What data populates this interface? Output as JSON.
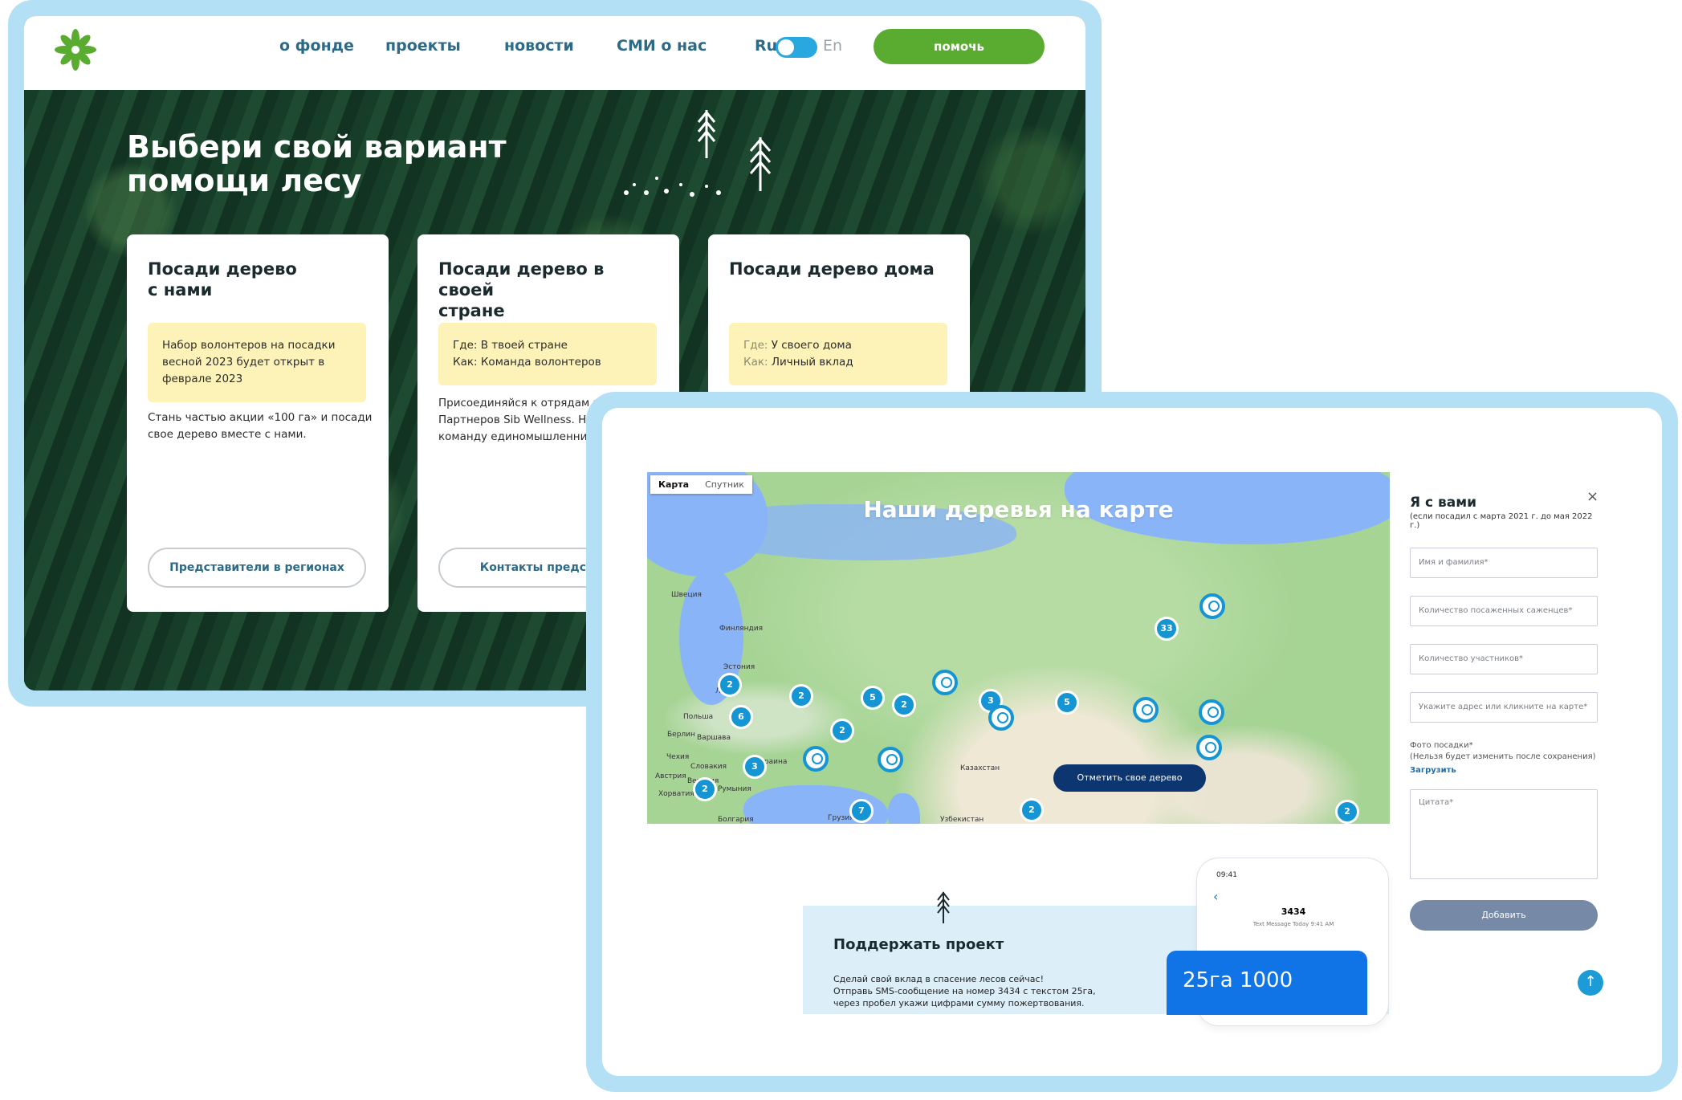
{
  "nav": {
    "about": "о фонде",
    "projects": "проекты",
    "news": "новости",
    "media": "СМИ о нас",
    "lang_ru": "Ru",
    "lang_en": "En",
    "help": "помочь"
  },
  "hero": {
    "title_line1": "Выбери свой вариант",
    "title_line2": "помощи лесу"
  },
  "cards": [
    {
      "title_l1": "Посади дерево",
      "title_l2": "с нами",
      "note": "Набор волонтеров на посадки весной 2023 будет открыт в феврале 2023",
      "text": "Стань частью акции «100 га» и посади свое дерево вместе с нами.",
      "button": "Представители в регионах"
    },
    {
      "title_l1": "Посади дерево в своей",
      "title_l2": "стране",
      "note_l1": "Где: В твоей стране",
      "note_l2": "Как: Команда волонтеров",
      "text": "Присоединяйся к отрядам или Бизнес-Партнеров Sib Wellness. Найди команду единомышленников в сво",
      "button": "Контакты представи"
    },
    {
      "title_l1": "Посади дерево дома",
      "note_l1_k": "Где:",
      "note_l1_v": "У своего дома",
      "note_l2_k": "Как:",
      "note_l2_v": "Личный вклад"
    }
  ],
  "map": {
    "tab_map": "Карта",
    "tab_sat": "Спутник",
    "title": "Наши деревья на карте",
    "mark_button": "Отметить свое дерево",
    "pins": [
      "2",
      "6",
      "2",
      "5",
      "2",
      "2",
      "3",
      "3",
      "5",
      "7",
      "2",
      "33",
      "2",
      "2"
    ],
    "cities": [
      "Швеция",
      "Финляндия",
      "Эстония",
      "Литва",
      "Польша",
      "Берлин",
      "Варшава",
      "Чехия",
      "Словакия",
      "Австрия",
      "Венгрия",
      "Хорватия",
      "Румыния",
      "Украина",
      "Болгария",
      "Грузия",
      "Казахстан",
      "Узбекистан"
    ]
  },
  "form": {
    "title": "Я с вами",
    "subtitle": "(если посадил с марта 2021 г. до мая 2022 г.)",
    "name": "Имя и фамилия*",
    "seedlings": "Количество посаженных саженцев*",
    "participants": "Количество участников*",
    "address": "Укажите адрес или кликните на карте*",
    "photo_l1": "Фото посадки*",
    "photo_l2": "(Нельзя будет изменить после сохранения)",
    "upload": "Загрузить",
    "quote": "Цитата*",
    "add": "Добавить",
    "close": "×"
  },
  "support": {
    "title": "Поддержать проект",
    "l1": "Сделай свой вклад в спасение лесов сейчас!",
    "l2": "Отправь SMS-сообщение на номер 3434 с текстом 25га,",
    "l3": "через пробел укажи цифрами сумму пожертвования."
  },
  "phone": {
    "time": "09:41",
    "number": "3434",
    "sub": "Text Message Today 9:41 AM",
    "bubble": "25га 1000"
  },
  "colors": {
    "accent_green": "#59ac2f",
    "accent_blue": "#1595d3",
    "frame": "#b4e0f6",
    "note": "#fdf3b8"
  },
  "icons": [
    "logo-icon",
    "tree-icon",
    "close-icon",
    "back-arrow-icon",
    "up-arrow-icon"
  ]
}
